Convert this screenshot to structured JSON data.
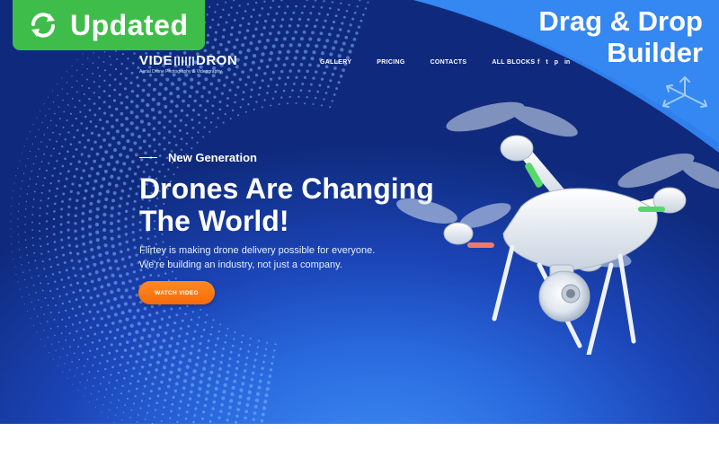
{
  "badge": {
    "label": "Updated",
    "color": "#3fbd4a"
  },
  "promo": {
    "line1": "Drag & Drop",
    "line2": "Builder",
    "color": "#2f80ed"
  },
  "brand": {
    "name_left": "VIDE",
    "name_right": "DRON",
    "tagline": "Aerial Drone Photography & Videography"
  },
  "nav": {
    "items": [
      "GALLERY",
      "PRICING",
      "CONTACTS",
      "ALL BLOCKS"
    ]
  },
  "social": {
    "icons": [
      "facebook-icon",
      "twitter-icon",
      "pinterest-icon",
      "linkedin-icon"
    ],
    "glyphs": [
      "f",
      "t",
      "p",
      "in"
    ]
  },
  "hero": {
    "eyebrow": "New Generation",
    "headline_line1": "Drones Are Changing",
    "headline_line2": "The World!",
    "subtext_line1": "Flirtey is making drone delivery possible for everyone.",
    "subtext_line2": "We're building an industry, not just a company.",
    "cta": "WATCH VIDEO",
    "cta_color": "#f57c14"
  }
}
